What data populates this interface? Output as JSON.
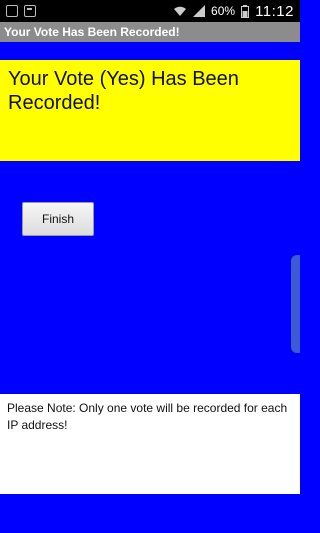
{
  "status_bar": {
    "battery": "60%",
    "time": "11:12",
    "icons": [
      "notification-icon",
      "chat-icon",
      "wifi-icon",
      "signal-icon",
      "battery-icon"
    ]
  },
  "title_bar": {
    "title": "Your Vote Has Been Recorded!"
  },
  "main": {
    "message": "Your Vote (Yes) Has Been Recorded!",
    "finish_label": "Finish",
    "note": "Please Note: Only one vote will be recorded for each IP address!"
  },
  "colors": {
    "background": "#0000ff",
    "message_bg": "#ffff00",
    "title_bar": "#8c8c8c",
    "note_bg": "#ffffff"
  }
}
